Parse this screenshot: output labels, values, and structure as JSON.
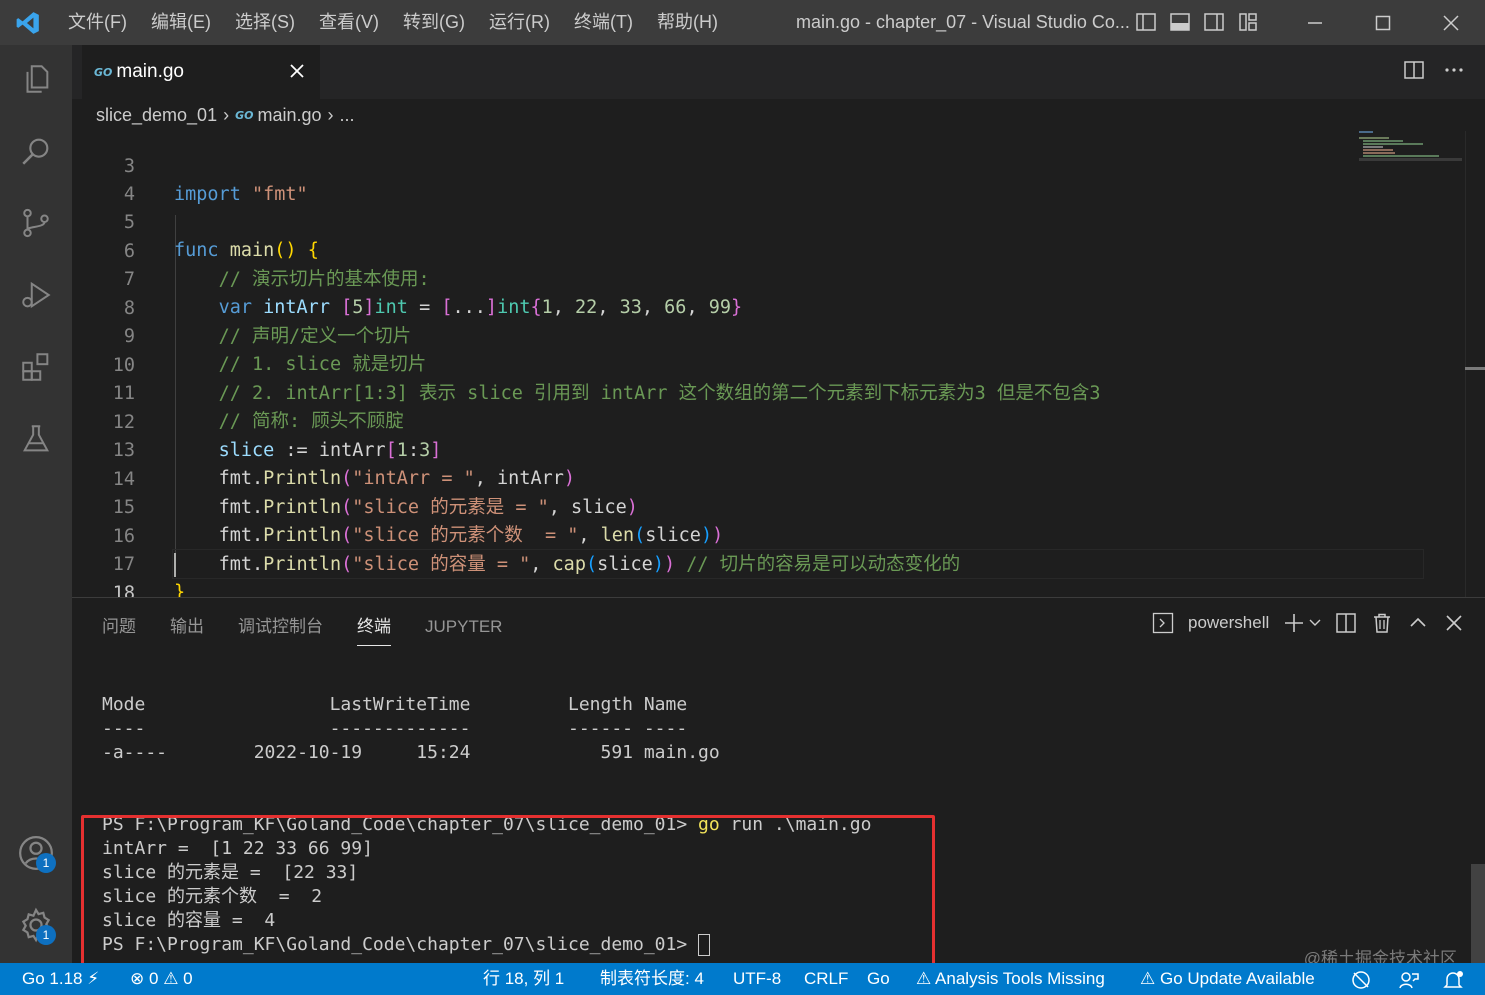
{
  "titlebar": {
    "menu": [
      "文件(F)",
      "编辑(E)",
      "选择(S)",
      "查看(V)",
      "转到(G)",
      "运行(R)",
      "终端(T)",
      "帮助(H)"
    ],
    "window_title": "main.go - chapter_07 - Visual Studio Co..."
  },
  "tab": {
    "label": "main.go",
    "badge": "GO"
  },
  "breadcrumb": {
    "folder": "slice_demo_01",
    "file": "main.go",
    "more": "..."
  },
  "editor": {
    "line_numbers": [
      "3",
      "4",
      "5",
      "6",
      "7",
      "8",
      "9",
      "10",
      "11",
      "12",
      "13",
      "14",
      "15",
      "16",
      "17",
      "18"
    ],
    "active_line": "18",
    "comments": {
      "c6": "// 演示切片的基本使用:",
      "c8": "// 声明/定义一个切片",
      "c9": "// 1. slice 就是切片",
      "c10": "// 2. intArr[1:3] 表示 slice 引用到 intArr 这个数组的第二个元素到下标元素为3 但是不包含3",
      "c11": "// 简称: 顾头不顾腚",
      "c16": "// 切片的容易是可以动态变化的"
    },
    "tokens": {
      "import": "import",
      "fmt_str": "\"fmt\"",
      "func": "func",
      "main": "main",
      "var": "var",
      "intArr": "intArr",
      "n5": "5",
      "int": "int",
      "dots": "...",
      "n1": "1",
      "n22": "22",
      "n33": "33",
      "n66": "66",
      "n99": "99",
      "slice": "slice",
      "assign": ":=",
      "n3": "3",
      "fmt": "fmt",
      "println": "Println",
      "len": "len",
      "cap": "cap",
      "s13": "\"intArr = \"",
      "s14": "\"slice 的元素是 = \"",
      "s15": "\"slice 的元素个数  = \"",
      "s16": "\"slice 的容量 = \""
    }
  },
  "panel": {
    "tabs": [
      "问题",
      "输出",
      "调试控制台",
      "终端",
      "JUPYTER"
    ],
    "active_tab": "终端",
    "shell": "powershell"
  },
  "terminal": {
    "header": "Mode                 LastWriteTime         Length Name",
    "divider": "----                 -------------         ------ ----",
    "row": "-a----        2022-10-19     15:24            591 main.go",
    "prompt": "PS F:\\Program_KF\\Goland_Code\\chapter_07\\slice_demo_01> ",
    "cmd_go": "go",
    "cmd_rest": " run .\\main.go",
    "out1": "intArr =  [1 22 33 66 99]",
    "out2": "slice 的元素是 =  [22 33]",
    "out3": "slice 的元素个数  =  2",
    "out4": "slice 的容量 =  4"
  },
  "watermark": "@稀土掘金技术社区",
  "statusbar": {
    "go_version": "Go 1.18",
    "errors": "0",
    "warnings": "0",
    "position": "行 18, 列 1",
    "tab_size": "制表符长度: 4",
    "encoding": "UTF-8",
    "eol": "CRLF",
    "language": "Go",
    "analysis": "Analysis Tools Missing",
    "update": "Go Update Available"
  },
  "activity_badges": {
    "accounts": "1",
    "settings": "1"
  },
  "colors": {
    "accent": "#007acc",
    "highlight_box": "#e53030"
  }
}
